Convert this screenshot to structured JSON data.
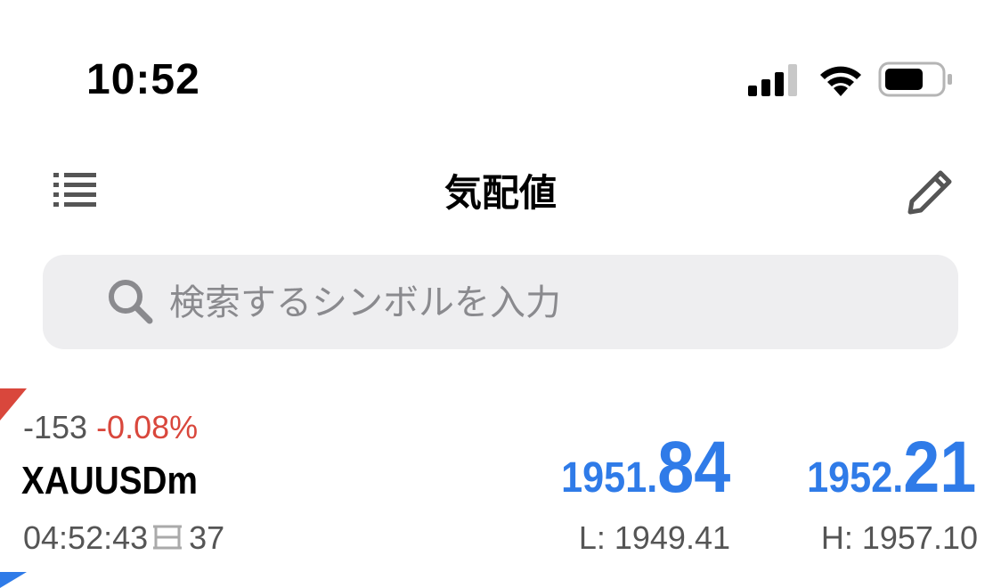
{
  "status_bar": {
    "time": "10:52",
    "signal_icon": "cellular-signal-icon",
    "wifi_icon": "wifi-icon",
    "battery_icon": "battery-icon",
    "signal_bars_active": 3,
    "signal_bars_total": 4,
    "battery_level": 0.7
  },
  "nav": {
    "title": "気配値",
    "menu_icon": "list-menu-icon",
    "edit_icon": "pencil-icon"
  },
  "search": {
    "placeholder": "検索するシンボルを入力",
    "value": "",
    "icon": "search-icon"
  },
  "quotes": [
    {
      "symbol": "XAUUSDm",
      "change_points": "-153",
      "change_percent": "-0.08%",
      "time": "04:52:43",
      "spread": "37",
      "bid_prefix": "1951.",
      "bid_big": "84",
      "ask_prefix": "1952.",
      "ask_big": "21",
      "low": "L: 1949.41",
      "high": "H: 1957.10"
    }
  ],
  "colors": {
    "accent_blue": "#2f7be8",
    "down_red": "#d9473c",
    "search_bg": "#eeeef0"
  }
}
